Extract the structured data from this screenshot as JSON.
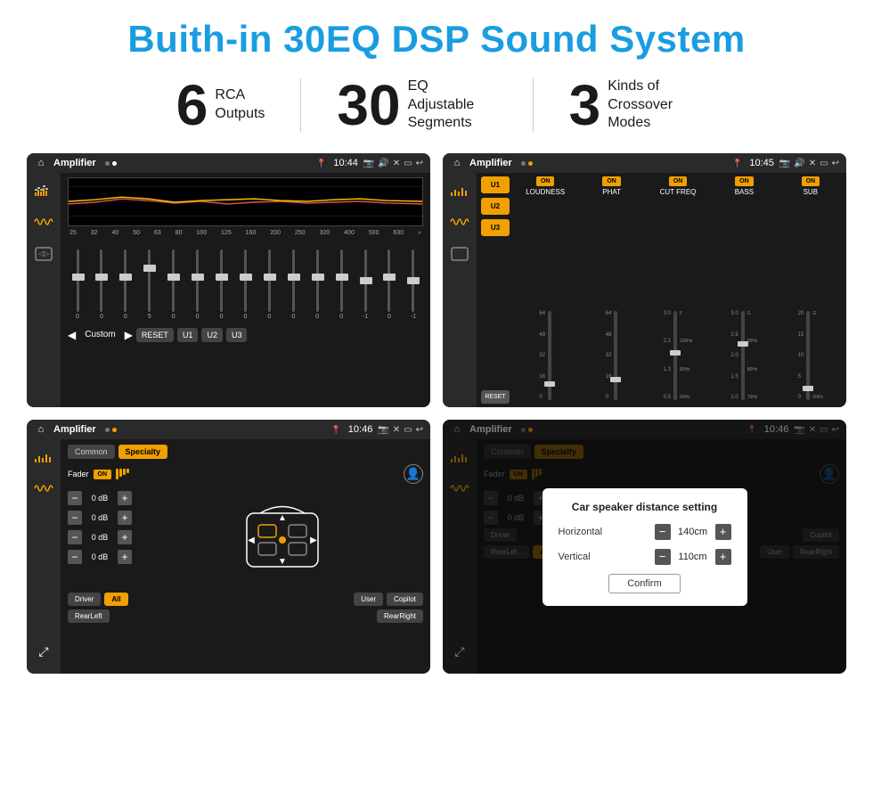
{
  "title": "Buith-in 30EQ DSP Sound System",
  "stats": [
    {
      "number": "6",
      "label_line1": "RCA",
      "label_line2": "Outputs"
    },
    {
      "number": "30",
      "label_line1": "EQ Adjustable",
      "label_line2": "Segments"
    },
    {
      "number": "3",
      "label_line1": "Kinds of",
      "label_line2": "Crossover Modes"
    }
  ],
  "screens": [
    {
      "id": "screen1",
      "app_name": "Amplifier",
      "time": "10:44",
      "type": "equalizer",
      "eq_labels": [
        "25",
        "32",
        "40",
        "50",
        "63",
        "80",
        "100",
        "125",
        "160",
        "200",
        "250",
        "320",
        "400",
        "500",
        "630"
      ],
      "eq_values": [
        "0",
        "0",
        "0",
        "5",
        "0",
        "0",
        "0",
        "0",
        "0",
        "0",
        "0",
        "0",
        "-1",
        "0",
        "-1"
      ],
      "mode_label": "Custom",
      "buttons": [
        "RESET",
        "U1",
        "U2",
        "U3"
      ]
    },
    {
      "id": "screen2",
      "app_name": "Amplifier",
      "time": "10:45",
      "type": "channels",
      "presets": [
        "U1",
        "U2",
        "U3"
      ],
      "channels": [
        "LOUDNESS",
        "PHAT",
        "CUT FREQ",
        "BASS",
        "SUB"
      ],
      "reset_label": "RESET"
    },
    {
      "id": "screen3",
      "app_name": "Amplifier",
      "time": "10:46",
      "type": "crossover",
      "tabs": [
        "Common",
        "Specialty"
      ],
      "active_tab": "Specialty",
      "fader_label": "Fader",
      "fader_on": "ON",
      "db_rows": [
        {
          "value": "0 dB"
        },
        {
          "value": "0 dB"
        },
        {
          "value": "0 dB"
        },
        {
          "value": "0 dB"
        }
      ],
      "bottom_buttons": [
        "Driver",
        "All",
        "User",
        "Copilot",
        "RearLeft",
        "RearRight"
      ]
    },
    {
      "id": "screen4",
      "app_name": "Amplifier",
      "time": "10:46",
      "type": "distance-dialog",
      "tabs": [
        "Common",
        "Specialty"
      ],
      "dialog": {
        "title": "Car speaker distance setting",
        "horizontal_label": "Horizontal",
        "horizontal_value": "140cm",
        "vertical_label": "Vertical",
        "vertical_value": "110cm",
        "confirm_label": "Confirm"
      },
      "db_rows": [
        {
          "value": "0 dB"
        },
        {
          "value": "0 dB"
        }
      ]
    }
  ]
}
